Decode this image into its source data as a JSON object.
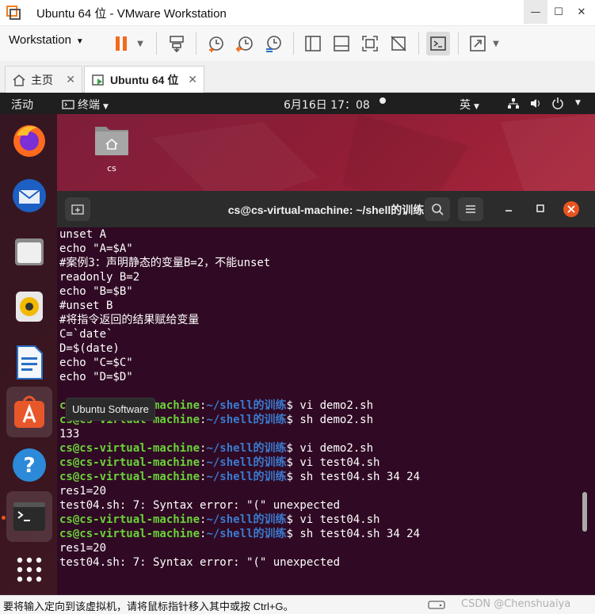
{
  "window": {
    "title": "Ubuntu 64 位 - VMware Workstation",
    "buttons": {
      "minimize": "—",
      "maximize": "☐",
      "close": "✕"
    }
  },
  "toolbar": {
    "menu_label": "Workstation",
    "accent": "#f26b1d"
  },
  "tabs": [
    {
      "label": "主页",
      "icon": "home-icon"
    },
    {
      "label": "Ubuntu 64 位",
      "icon": "vm-running-icon"
    }
  ],
  "ubuntu": {
    "activities": "活动",
    "app_menu": "终端",
    "clock": "6月16日  17：08",
    "input_method": "英",
    "desktop_icon_label": "cs",
    "tooltip": "Ubuntu Software"
  },
  "terminal": {
    "title": "cs@cs-virtual-machine: ~/shell的训练",
    "user": "cs@cs-virtual-machine",
    "path": "~/shell的训练",
    "lines": [
      {
        "type": "text",
        "text": "unset A"
      },
      {
        "type": "text",
        "text": "echo \"A=$A\""
      },
      {
        "type": "text",
        "text": "#案例3：声明静态的变量B=2，不能unset"
      },
      {
        "type": "text",
        "text": "readonly B=2"
      },
      {
        "type": "text",
        "text": "echo \"B=$B\""
      },
      {
        "type": "text",
        "text": "#unset B"
      },
      {
        "type": "text",
        "text": "#将指令返回的结果赋给变量"
      },
      {
        "type": "text",
        "text": "C=`date`"
      },
      {
        "type": "text",
        "text": "D=$(date)"
      },
      {
        "type": "text",
        "text": "echo \"C=$C\""
      },
      {
        "type": "text",
        "text": "echo \"D=$D\""
      },
      {
        "type": "text",
        "text": ""
      },
      {
        "type": "prompt",
        "cmd": "vi demo2.sh"
      },
      {
        "type": "prompt",
        "cmd": "sh demo2.sh"
      },
      {
        "type": "text",
        "text": "133"
      },
      {
        "type": "prompt",
        "cmd": "vi demo2.sh"
      },
      {
        "type": "prompt",
        "cmd": "vi test04.sh"
      },
      {
        "type": "prompt",
        "cmd": "sh test04.sh 34 24"
      },
      {
        "type": "text",
        "text": "res1=20"
      },
      {
        "type": "text",
        "text": "test04.sh: 7: Syntax error: \"(\" unexpected"
      },
      {
        "type": "prompt",
        "cmd": "vi test04.sh"
      },
      {
        "type": "prompt",
        "cmd": "sh test04.sh 34 24"
      },
      {
        "type": "text",
        "text": "res1=20"
      },
      {
        "type": "text",
        "text": "test04.sh: 7: Syntax error: \"(\" unexpected"
      }
    ]
  },
  "statusbar": {
    "message": "要将输入定向到该虚拟机，请将鼠标指针移入其中或按 Ctrl+G。",
    "watermark": "CSDN @Chenshuaiya"
  }
}
